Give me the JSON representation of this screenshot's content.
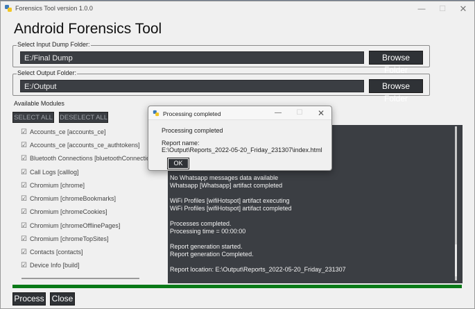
{
  "window": {
    "title": "Forensics Tool version 1.0.0",
    "controls": {
      "minimize": "—",
      "maximize": "☐",
      "close": "✕"
    }
  },
  "heading": "Android Forensics Tool",
  "input_folder": {
    "legend": "Select Input Dump Folder:",
    "value": "E:/Final Dump",
    "browse_label": "Browse Folder"
  },
  "output_folder": {
    "legend": "Select Output Folder:",
    "value": "E:/Output",
    "browse_label": "Browse Folder"
  },
  "modules": {
    "label": "Available Modules",
    "select_all": "SELECT ALL",
    "deselect_all": "DESELECT ALL",
    "items": [
      {
        "label": "Accounts_ce [accounts_ce]",
        "checked": true
      },
      {
        "label": "Accounts_ce [accounts_ce_authtokens]",
        "checked": true
      },
      {
        "label": "Bluetooth Connections [bluetoothConnectio",
        "checked": true
      },
      {
        "label": "Call Logs [calllog]",
        "checked": true
      },
      {
        "label": "Chromium [chrome]",
        "checked": true
      },
      {
        "label": "Chromium [chromeBookmarks]",
        "checked": true
      },
      {
        "label": "Chromium [chromeCookies]",
        "checked": true
      },
      {
        "label": "Chromium [chromeOfflinePages]",
        "checked": true
      },
      {
        "label": "Chromium [chromeTopSites]",
        "checked": true
      },
      {
        "label": "Contacts [contacts]",
        "checked": true
      },
      {
        "label": "Device Info [build]",
        "checked": true
      }
    ]
  },
  "log": {
    "lines": [
      "No Whatsapp messages data available",
      "Whatsapp [Whatsapp] artifact completed",
      "",
      "WiFi Profiles [wifiHotspot] artifact executing",
      "WiFi Profiles [wifiHotspot] artifact completed",
      "",
      "Processes completed.",
      "Processing time = 00:00:00",
      "",
      "Report generation started.",
      "Report generation Completed.",
      "",
      "Report location: E:\\Output\\Reports_2022-05-20_Friday_231307"
    ]
  },
  "progress": {
    "fraction": 1.0,
    "color": "#0a7a18"
  },
  "buttons": {
    "process": "Process",
    "close": "Close"
  },
  "dialog": {
    "title": "Processing completed",
    "message": "Processing completed",
    "report_label": "Report name:",
    "report_path": "E:\\Output\\Reports_2022-05-20_Friday_231307\\index.html",
    "ok": "OK",
    "controls": {
      "minimize": "—",
      "maximize": "☐",
      "close": "✕"
    }
  }
}
